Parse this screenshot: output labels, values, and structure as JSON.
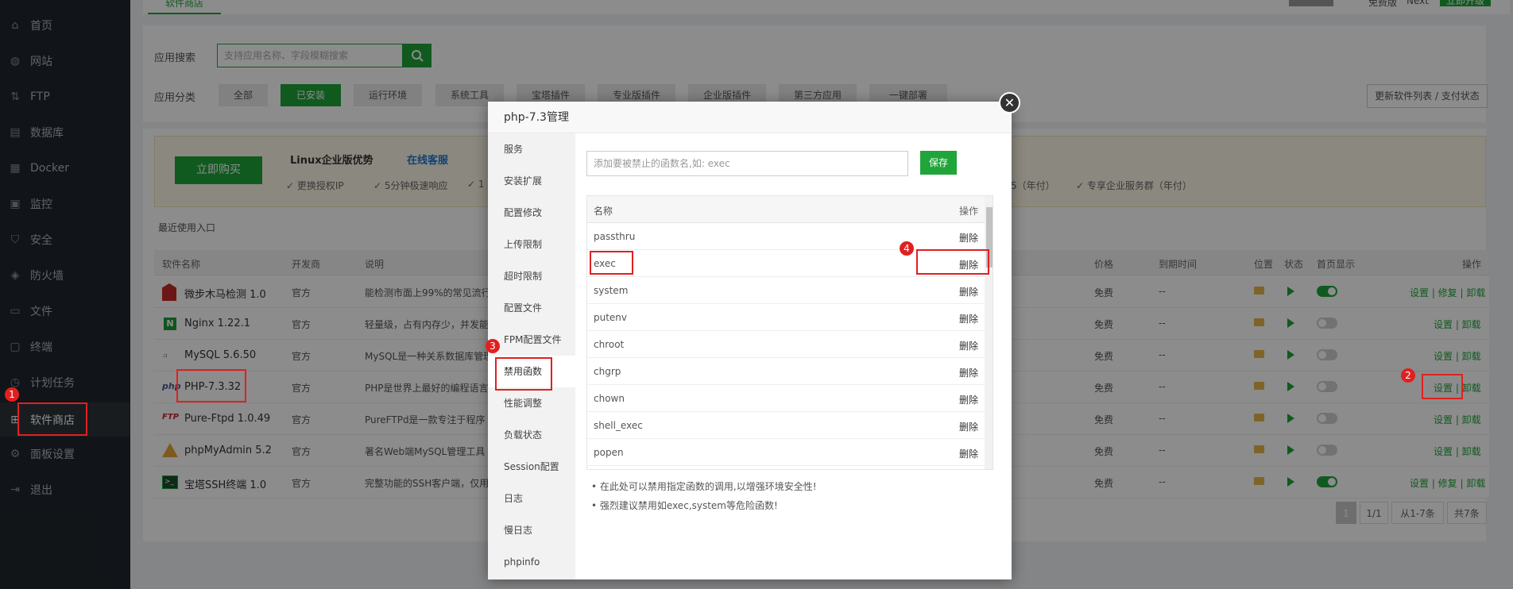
{
  "sidebar": {
    "items": [
      {
        "label": "首页",
        "icon": "home-icon"
      },
      {
        "label": "网站",
        "icon": "globe-icon"
      },
      {
        "label": "FTP",
        "icon": "ftp-icon"
      },
      {
        "label": "数据库",
        "icon": "database-icon"
      },
      {
        "label": "Docker",
        "icon": "docker-icon"
      },
      {
        "label": "监控",
        "icon": "monitor-icon"
      },
      {
        "label": "安全",
        "icon": "shield-icon"
      },
      {
        "label": "防火墙",
        "icon": "firewall-icon"
      },
      {
        "label": "文件",
        "icon": "folder-icon"
      },
      {
        "label": "终端",
        "icon": "terminal-icon"
      },
      {
        "label": "计划任务",
        "icon": "clock-icon"
      },
      {
        "label": "软件商店",
        "icon": "grid-icon"
      },
      {
        "label": "面板设置",
        "icon": "gear-icon"
      },
      {
        "label": "退出",
        "icon": "logout-icon"
      }
    ]
  },
  "header": {
    "tab": "软件商店",
    "right_label_1": "免费版",
    "right_label_2": "Next",
    "upgrade_button": "立即升级"
  },
  "search": {
    "label": "应用搜索",
    "placeholder": "支持应用名称、字段模糊搜索"
  },
  "categories": {
    "label": "应用分类",
    "items": [
      "全部",
      "已安装",
      "运行环境",
      "系统工具",
      "宝塔插件",
      "专业版插件",
      "企业版插件",
      "第三方应用",
      "一键部署"
    ],
    "update_button": "更新软件列表 / 支付状态"
  },
  "promo": {
    "buy_button": "立即购买",
    "title": "Linux企业版优势",
    "service": "在线客服",
    "features": [
      "✓ 更换授权IP",
      "✓ 5分钟极速响应",
      "✓ 1"
    ],
    "right_features": [
      "5（年付）",
      "✓ 专享企业服务群（年付）"
    ]
  },
  "recent": {
    "label": "最近使用入口"
  },
  "table": {
    "headers": [
      "软件名称",
      "开发商",
      "说明",
      "价格",
      "到期时间",
      "位置",
      "状态",
      "首页显示",
      "操作"
    ],
    "rows": [
      {
        "name": "微步木马检测 1.0",
        "dev": "官方",
        "desc": "能检测市面上99%的常见流行",
        "price": "免费",
        "expire": "--",
        "home": true,
        "actions": "设置 | 修复 | 卸载"
      },
      {
        "name": "Nginx 1.22.1",
        "dev": "官方",
        "desc": "轻量级，占有内存少，并发能",
        "price": "免费",
        "expire": "--",
        "home": false,
        "actions": "设置 | 卸载"
      },
      {
        "name": "MySQL 5.6.50",
        "dev": "官方",
        "desc": "MySQL是一种关系数据库管理",
        "price": "免费",
        "expire": "--",
        "home": false,
        "actions": "设置 | 卸载"
      },
      {
        "name": "PHP-7.3.32",
        "dev": "官方",
        "desc": "PHP是世界上最好的编程语言",
        "price": "免费",
        "expire": "--",
        "home": false,
        "actions": "设置 | 卸载"
      },
      {
        "name": "Pure-Ftpd 1.0.49",
        "dev": "官方",
        "desc": "PureFTPd是一款专注于程序",
        "price": "免费",
        "expire": "--",
        "home": false,
        "actions": "设置 | 卸载"
      },
      {
        "name": "phpMyAdmin 5.2",
        "dev": "官方",
        "desc": "著名Web端MySQL管理工具",
        "price": "免费",
        "expire": "--",
        "home": false,
        "actions": "设置 | 卸载"
      },
      {
        "name": "宝塔SSH终端 1.0",
        "dev": "官方",
        "desc": "完整功能的SSH客户端，仅用",
        "price": "免费",
        "expire": "--",
        "home": true,
        "actions": "设置 | 修复 | 卸载"
      }
    ]
  },
  "pagination": {
    "current": "1",
    "total_pages": "1/1",
    "range": "从1-7条",
    "count": "共7条"
  },
  "modal": {
    "title": "php-7.3管理",
    "menu": [
      "服务",
      "安装扩展",
      "配置修改",
      "上传限制",
      "超时限制",
      "配置文件",
      "FPM配置文件",
      "禁用函数",
      "性能调整",
      "负载状态",
      "Session配置",
      "日志",
      "慢日志",
      "phpinfo"
    ],
    "input_placeholder": "添加要被禁止的函数名,如: exec",
    "save_button": "保存",
    "col_name": "名称",
    "col_action": "操作",
    "functions": [
      "passthru",
      "exec",
      "system",
      "putenv",
      "chroot",
      "chgrp",
      "chown",
      "shell_exec",
      "popen"
    ],
    "delete_label": "删除",
    "tips": [
      "在此处可以禁用指定函数的调用,以增强环境安全性!",
      "强烈建议禁用如exec,system等危险函数!"
    ]
  },
  "annotations": [
    "1",
    "2",
    "3",
    "4"
  ]
}
